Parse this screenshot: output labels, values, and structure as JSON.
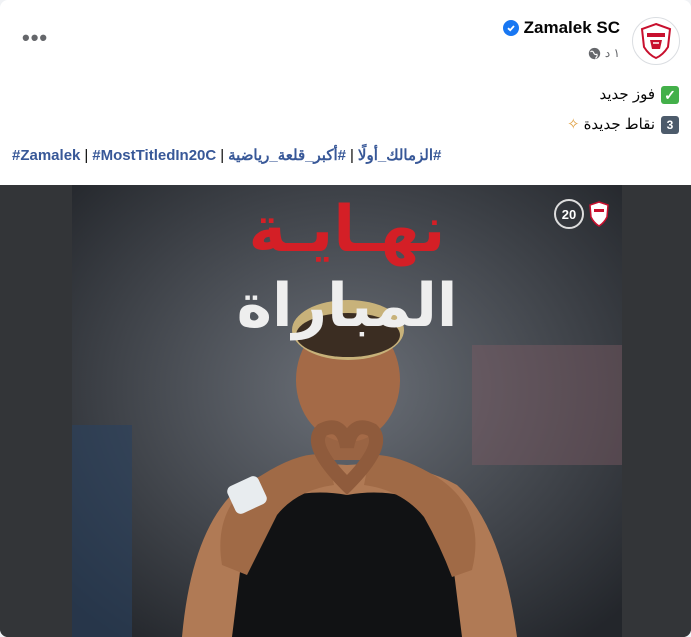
{
  "post": {
    "page_name": "Zamalek SC",
    "time_ago": "١ د",
    "line1": "فوز جديد",
    "line2": "نقاط جديدة",
    "hashtags": [
      "#Zamalek",
      "#MostTitledIn20C",
      "#أكبر_قلعة_رياضية",
      "#الزمالك_أولًا"
    ],
    "separator": "|"
  },
  "media": {
    "headline_red": "نهـايـة",
    "headline_white": "المباراة",
    "badge_number": "20"
  },
  "icons": {
    "more": "more-dots-icon",
    "verified": "verified-badge-icon",
    "globe": "globe-icon"
  },
  "colors": {
    "link": "#385898",
    "verified": "#1877f2",
    "headline_red": "#d41f26"
  }
}
